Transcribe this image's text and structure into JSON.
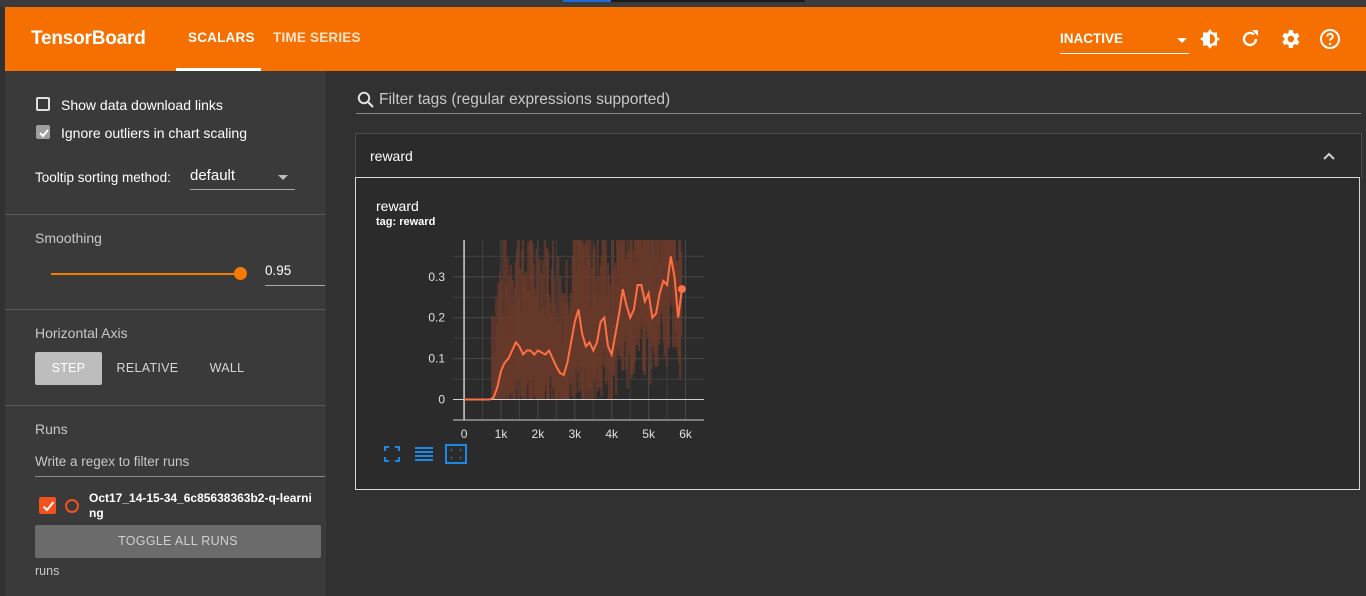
{
  "header": {
    "brand": "TensorBoard",
    "tabs": [
      {
        "label": "SCALARS",
        "active": true
      },
      {
        "label": "TIME SERIES",
        "active": false
      }
    ],
    "status_select": "INACTIVE",
    "icons": [
      "theme-icon",
      "reload-icon",
      "settings-icon",
      "help-icon"
    ],
    "accent": "#f57000"
  },
  "sidebar": {
    "show_download_links": {
      "label": "Show data download links",
      "checked": false
    },
    "ignore_outliers": {
      "label": "Ignore outliers in chart scaling",
      "checked": true
    },
    "tooltip_sorting": {
      "label": "Tooltip sorting method:",
      "value": "default"
    },
    "smoothing": {
      "label": "Smoothing",
      "value": "0.95",
      "level": 0.95
    },
    "horizontal_axis": {
      "label": "Horizontal Axis",
      "options": [
        "STEP",
        "RELATIVE",
        "WALL"
      ],
      "selected": "STEP"
    },
    "runs": {
      "label": "Runs",
      "filter_placeholder": "Write a regex to filter runs",
      "items": [
        {
          "name_line1": "Oct17_14-15-34_6c85638363b2-q-learni",
          "name_line2": "ng",
          "checked": true,
          "color": "#f4511e"
        }
      ],
      "toggle_all": "TOGGLE ALL RUNS",
      "footer": "runs"
    }
  },
  "main": {
    "filter_placeholder": "Filter tags (regular expressions supported)",
    "group": {
      "title": "reward"
    },
    "card": {
      "title": "reward",
      "tag": "tag: reward"
    }
  },
  "chart_data": {
    "type": "line",
    "title": "reward",
    "xlabel": "",
    "ylabel": "",
    "x_ticks": [
      "0",
      "1k",
      "2k",
      "3k",
      "4k",
      "5k",
      "6k"
    ],
    "y_ticks": [
      "0",
      "0.1",
      "0.2",
      "0.3"
    ],
    "xlim": [
      -300,
      6500
    ],
    "ylim": [
      -0.05,
      0.39
    ],
    "series": [
      {
        "color": "#ff7043",
        "x": [
          0,
          400,
          700,
          800,
          900,
          1000,
          1100,
          1200,
          1300,
          1400,
          1500,
          1600,
          1700,
          1800,
          1900,
          2000,
          2100,
          2200,
          2300,
          2400,
          2500,
          2600,
          2700,
          2800,
          2900,
          3000,
          3100,
          3200,
          3300,
          3400,
          3500,
          3600,
          3700,
          3800,
          3900,
          4000,
          4100,
          4200,
          4300,
          4400,
          4500,
          4600,
          4700,
          4800,
          4900,
          5000,
          5100,
          5200,
          5300,
          5400,
          5500,
          5600,
          5700,
          5800,
          5900
        ],
        "y": [
          0,
          0,
          0,
          0.005,
          0.03,
          0.07,
          0.09,
          0.1,
          0.12,
          0.14,
          0.13,
          0.11,
          0.12,
          0.12,
          0.11,
          0.12,
          0.115,
          0.11,
          0.12,
          0.1,
          0.08,
          0.065,
          0.06,
          0.09,
          0.14,
          0.19,
          0.22,
          0.16,
          0.13,
          0.14,
          0.12,
          0.14,
          0.19,
          0.2,
          0.13,
          0.11,
          0.16,
          0.21,
          0.27,
          0.23,
          0.2,
          0.22,
          0.28,
          0.28,
          0.24,
          0.26,
          0.2,
          0.21,
          0.26,
          0.29,
          0.28,
          0.35,
          0.3,
          0.2,
          0.27
        ]
      }
    ],
    "raw_color": "#6a3a2a"
  }
}
